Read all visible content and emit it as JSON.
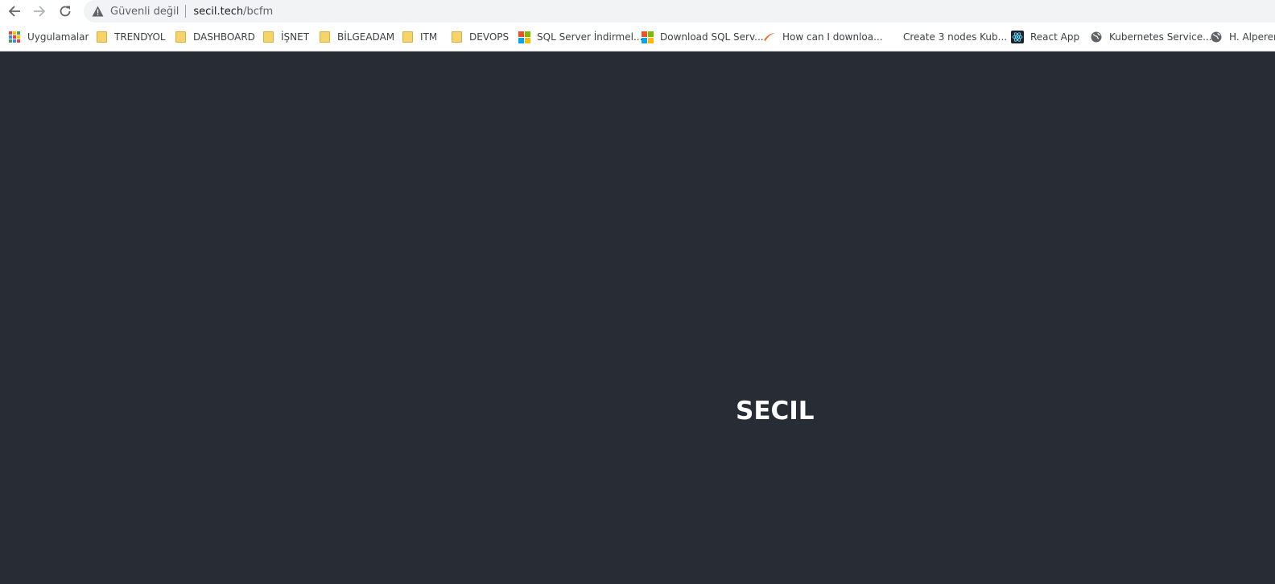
{
  "browser": {
    "security_label": "Güvenli değil",
    "url_host": "secil.tech",
    "url_path": "/bcfm",
    "icons": {
      "back": "back-arrow-icon",
      "forward": "forward-arrow-icon",
      "reload": "reload-icon",
      "security": "warning-triangle-icon"
    }
  },
  "bookmarks": [
    {
      "label": "Uygulamalar",
      "icon": "apps-grid-icon"
    },
    {
      "label": "TRENDYOL",
      "icon": "folder-icon"
    },
    {
      "label": "DASHBOARD",
      "icon": "folder-icon"
    },
    {
      "label": "İŞNET",
      "icon": "folder-icon"
    },
    {
      "label": "BİLGEADAM",
      "icon": "folder-icon"
    },
    {
      "label": "ITM",
      "icon": "folder-icon"
    },
    {
      "label": "DEVOPS",
      "icon": "folder-icon"
    },
    {
      "label": "SQL Server İndirmel...",
      "icon": "microsoft-logo-icon"
    },
    {
      "label": "Download SQL Serv...",
      "icon": "microsoft-logo-icon"
    },
    {
      "label": "How can I downloa...",
      "icon": "swoosh-logo-icon"
    },
    {
      "label": "Create 3 nodes Kub...",
      "icon": "none"
    },
    {
      "label": "React App",
      "icon": "react-logo-icon"
    },
    {
      "label": "Kubernetes Service...",
      "icon": "globe-icon"
    },
    {
      "label": "H. Alperen",
      "icon": "globe-icon"
    }
  ],
  "page": {
    "brand_text": "SECIL",
    "background_color": "#282c34",
    "text_color": "#ffffff"
  }
}
